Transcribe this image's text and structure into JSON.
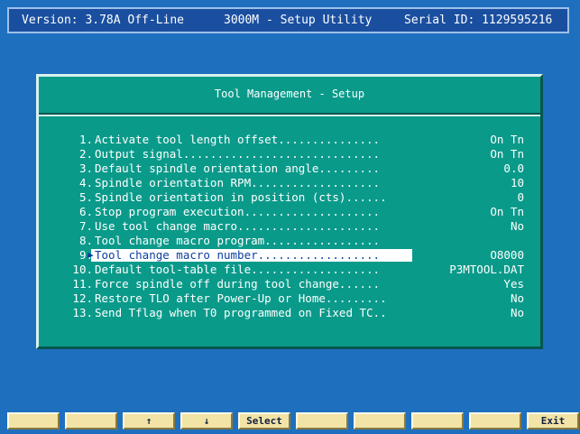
{
  "header": {
    "version": "Version: 3.78A Off-Line",
    "title": "3000M - Setup Utility",
    "serial": "Serial ID: 1129595216"
  },
  "dialog": {
    "title": "Tool Management - Setup",
    "items": [
      {
        "num": "1.",
        "label": "Activate tool length offset...............",
        "value": "On Tn"
      },
      {
        "num": "2.",
        "label": "Output signal.............................",
        "value": "On Tn"
      },
      {
        "num": "3.",
        "label": "Default spindle orientation angle.........",
        "value": "0.0"
      },
      {
        "num": "4.",
        "label": "Spindle orientation RPM...................",
        "value": "10"
      },
      {
        "num": "5.",
        "label": "Spindle orientation in position (cts)......",
        "value": "0"
      },
      {
        "num": "6.",
        "label": "Stop program execution....................",
        "value": "On Tn"
      },
      {
        "num": "7.",
        "label": "Use tool change macro.....................",
        "value": "No"
      },
      {
        "num": "8.",
        "label": "Tool change macro program.................",
        "value": ""
      },
      {
        "num": "9.",
        "label": "Tool change macro number..................",
        "value": "O8000"
      },
      {
        "num": "10.",
        "label": "Default tool-table file...................",
        "value": "P3MTOOL.DAT"
      },
      {
        "num": "11.",
        "label": "Force spindle off during tool change......",
        "value": "Yes"
      },
      {
        "num": "12.",
        "label": "Restore TLO after Power-Up or Home.........",
        "value": "No"
      },
      {
        "num": "13.",
        "label": "Send Tflag when T0 programmed on Fixed TC..",
        "value": "No"
      }
    ],
    "selected_index": 8
  },
  "function_keys": [
    "",
    "",
    "↑",
    "↓",
    "Select",
    "",
    "",
    "",
    "",
    "Exit"
  ],
  "colors": {
    "background": "#1f6fbf",
    "header_bg": "#1a4fa0",
    "dialog_bg": "#0a9a8a",
    "highlight_bg": "#ffffff",
    "highlight_text": "#0a3fa0",
    "fkey_bg": "#f2e3a6"
  }
}
